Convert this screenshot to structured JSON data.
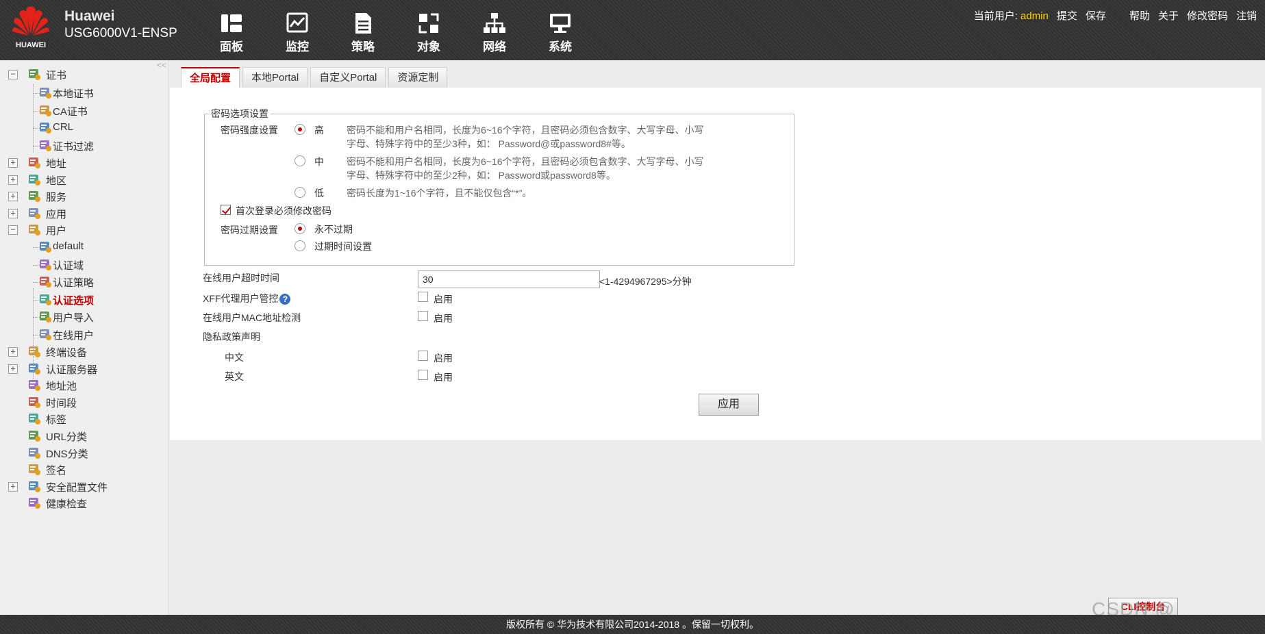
{
  "header": {
    "logo_text": "HUAWEI",
    "brand": "Huawei",
    "model": "USG6000V1-ENSP",
    "nav": [
      {
        "label": "面板",
        "icon": "dashboard-icon"
      },
      {
        "label": "监控",
        "icon": "monitor-icon"
      },
      {
        "label": "策略",
        "icon": "policy-icon"
      },
      {
        "label": "对象",
        "icon": "object-icon"
      },
      {
        "label": "网络",
        "icon": "network-icon"
      },
      {
        "label": "系统",
        "icon": "system-icon"
      }
    ],
    "user_label": "当前用户:",
    "username": "admin",
    "links": {
      "submit": "提交",
      "save": "保存",
      "help": "帮助",
      "about": "关于",
      "change_password": "修改密码",
      "logout": "注销"
    }
  },
  "sidebar": {
    "collapse": "<<",
    "items": [
      {
        "label": "证书",
        "level": 0,
        "toggle": "−",
        "icon": "certificate-icon"
      },
      {
        "label": "本地证书",
        "level": 1,
        "icon": "local-certificate-icon"
      },
      {
        "label": "CA证书",
        "level": 1,
        "icon": "ca-certificate-icon"
      },
      {
        "label": "CRL",
        "level": 1,
        "icon": "crl-icon"
      },
      {
        "label": "证书过滤",
        "level": 1,
        "icon": "certificate-filter-icon"
      },
      {
        "label": "地址",
        "level": 0,
        "toggle": "+",
        "icon": "address-icon"
      },
      {
        "label": "地区",
        "level": 0,
        "toggle": "+",
        "icon": "region-icon"
      },
      {
        "label": "服务",
        "level": 0,
        "toggle": "+",
        "icon": "service-icon"
      },
      {
        "label": "应用",
        "level": 0,
        "toggle": "+",
        "icon": "application-icon"
      },
      {
        "label": "用户",
        "level": 0,
        "toggle": "−",
        "icon": "user-icon"
      },
      {
        "label": "default",
        "level": 1,
        "icon": "user-default-icon"
      },
      {
        "label": "认证域",
        "level": 1,
        "icon": "auth-domain-icon"
      },
      {
        "label": "认证策略",
        "level": 1,
        "icon": "auth-policy-icon"
      },
      {
        "label": "认证选项",
        "level": 1,
        "icon": "auth-option-icon",
        "active": true
      },
      {
        "label": "用户导入",
        "level": 1,
        "icon": "user-import-icon"
      },
      {
        "label": "在线用户",
        "level": 1,
        "icon": "online-user-icon"
      },
      {
        "label": "终端设备",
        "level": 0,
        "toggle": "+",
        "icon": "terminal-device-icon"
      },
      {
        "label": "认证服务器",
        "level": 0,
        "toggle": "+",
        "icon": "auth-server-icon"
      },
      {
        "label": "地址池",
        "level": 0,
        "icon": "address-pool-icon"
      },
      {
        "label": "时间段",
        "level": 0,
        "icon": "time-range-icon"
      },
      {
        "label": "标签",
        "level": 0,
        "icon": "tag-icon"
      },
      {
        "label": "URL分类",
        "level": 0,
        "icon": "url-category-icon"
      },
      {
        "label": "DNS分类",
        "level": 0,
        "icon": "dns-category-icon"
      },
      {
        "label": "签名",
        "level": 0,
        "icon": "signature-icon"
      },
      {
        "label": "安全配置文件",
        "level": 0,
        "toggle": "+",
        "icon": "security-profile-icon"
      },
      {
        "label": "健康检查",
        "level": 0,
        "icon": "health-check-icon"
      }
    ]
  },
  "tabs": [
    {
      "label": "全局配置",
      "active": true
    },
    {
      "label": "本地Portal"
    },
    {
      "label": "自定义Portal"
    },
    {
      "label": "资源定制"
    }
  ],
  "form": {
    "password_section": {
      "legend": "密码选项设置",
      "strength_label": "密码强度设置",
      "options": [
        {
          "label": "高",
          "selected": true,
          "desc1": "密码不能和用户名相同，长度为6~16个字符，且密码必须包含数字、大写字母、小写",
          "desc2": "字母、特殊字符中的至少3种，如： Password@或password8#等。"
        },
        {
          "label": "中",
          "selected": false,
          "desc1": "密码不能和用户名相同，长度为6~16个字符，且密码必须包含数字、大写字母、小写",
          "desc2": "字母、特殊字符中的至少2种，如： Password或password8等。"
        },
        {
          "label": "低",
          "selected": false,
          "desc1": "密码长度为1~16个字符，且不能仅包含“*”。",
          "desc2": ""
        }
      ],
      "first_login_label": "首次登录必须修改密码",
      "first_login_checked": true,
      "expire_label": "密码过期设置",
      "expire_options": [
        {
          "label": "永不过期",
          "selected": true
        },
        {
          "label": "过期时间设置",
          "selected": false
        }
      ]
    },
    "online_timeout_label": "在线用户超时时间",
    "online_timeout_value": "30",
    "online_timeout_range": "<1-4294967295>分钟",
    "xff_label": "XFF代理用户管控",
    "help_glyph": "?",
    "mac_detect_label": "在线用户MAC地址检测",
    "privacy_label": "隐私政策声明",
    "chinese_label": "中文",
    "english_label": "英文",
    "enable_label": "启用",
    "apply_label": "应用"
  },
  "cli_label": "CLI控制台",
  "watermark": "CSDN @",
  "footer": "版权所有 © 华为技术有限公司2014-2018 。保留一切权利。"
}
